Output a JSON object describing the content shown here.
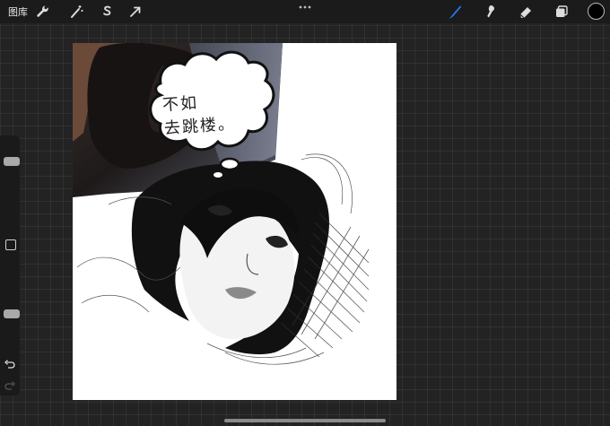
{
  "toolbar": {
    "gallery_label": "图库",
    "actions_icon": "wrench-icon",
    "adjustments_icon": "magic-wand-icon",
    "selection_icon": "selection-s-icon",
    "transform_icon": "arrow-cursor-icon",
    "more_icon": "ellipsis-icon",
    "brush_icon": "brush-icon",
    "smudge_icon": "smudge-icon",
    "eraser_icon": "eraser-icon",
    "layers_icon": "layers-icon",
    "active_tool": "brush",
    "accent_color": "#2f7bff",
    "current_color": "#000000"
  },
  "sidebar": {
    "brush_size_level": 0.78,
    "opacity_level": 0.22,
    "modify_icon": "square-icon",
    "undo_icon": "undo-icon",
    "redo_icon": "redo-icon"
  },
  "canvas": {
    "speech_bubble_text": "不如\n去跳楼。"
  }
}
